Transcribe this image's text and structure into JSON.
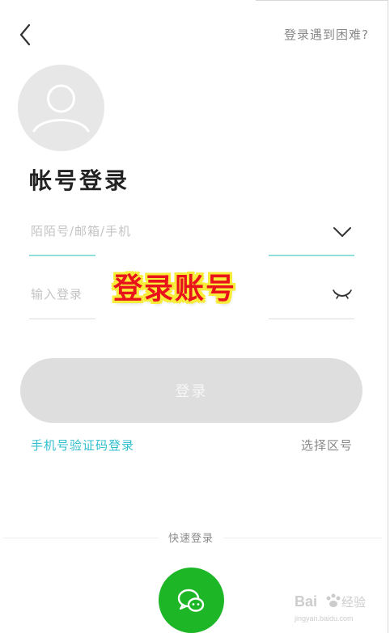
{
  "header": {
    "back_icon": "chevron-left-icon",
    "help_link": "登录遇到困难?"
  },
  "avatar": {
    "icon": "user-placeholder-icon"
  },
  "title": "帐号登录",
  "form": {
    "account": {
      "value": "",
      "placeholder": "陌陌号/邮箱/手机",
      "dropdown_icon": "chevron-down-icon"
    },
    "password": {
      "value": "",
      "placeholder": "输入登录",
      "toggle_icon": "eye-closed-icon"
    }
  },
  "overlay_caption": "登录账号",
  "login_button": "登录",
  "links": {
    "sms_login": "手机号验证码登录",
    "region": "选择区号"
  },
  "quick_login": {
    "label": "快速登录",
    "wechat_icon": "wechat-icon"
  },
  "watermark": {
    "text": "Bai 经验",
    "subtext": "jingyan.baidu.com"
  },
  "colors": {
    "accent_teal": "#33bfcf",
    "underline_teal": "#8fe0dc",
    "wechat_green": "#1db627",
    "button_disabled": "#dedede",
    "caption_red": "#e8131b",
    "caption_outline": "#f7ec3a"
  }
}
